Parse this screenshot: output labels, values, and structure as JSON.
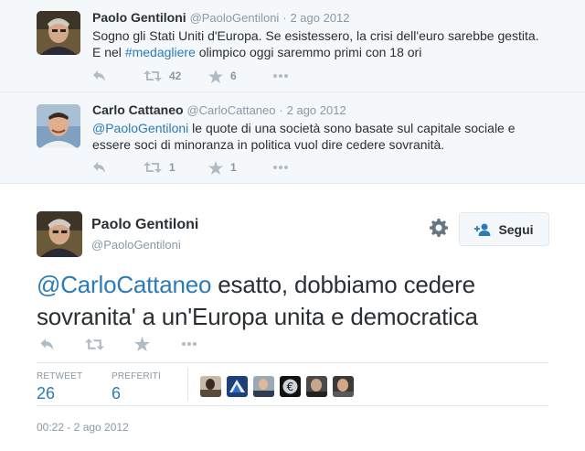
{
  "context_tweets": [
    {
      "fullname": "Paolo Gentiloni",
      "username": "@PaoloGentiloni",
      "separator": "·",
      "time": "2 ago 2012",
      "text_line1": "Sogno gli Stati Uniti d'Europa. Se esistessero, la crisi dell'euro sarebbe gestita.",
      "text_line2_pre": "E nel ",
      "hashtag": "#medagliere",
      "text_line2_post": " olimpico oggi saremmo primi con 18 ori",
      "retweets": "42",
      "favorites": "6"
    },
    {
      "fullname": "Carlo Cattaneo",
      "username": "@CarloCattaneo",
      "separator": "·",
      "time": "2 ago 2012",
      "mention": "@PaoloGentiloni",
      "text_line1_post": " le quote di una società sono basate sul capitale sociale e",
      "text_line2": "essere soci di minoranza in politica vuol dire cedere sovranità.",
      "retweets": "1",
      "favorites": "1"
    }
  ],
  "main_tweet": {
    "fullname": "Paolo Gentiloni",
    "username": "@PaoloGentiloni",
    "follow_label": "Segui",
    "mention": "@CarloCattaneo",
    "text_line1_post": " esatto, dobbiamo cedere",
    "text_line2": "sovranita' a un'Europa unita e democratica",
    "retweet_label": "RETWEET",
    "retweet_count": "26",
    "favorites_label": "PREFERITI",
    "favorites_count": "6",
    "timestamp": "00:22 - 2 ago 2012"
  },
  "icons": {
    "reply": "reply-icon",
    "retweet": "retweet-icon",
    "favorite": "star-icon",
    "more": "more-icon",
    "gear": "gear-icon",
    "follow": "add-user-icon"
  },
  "colors": {
    "link": "#2b7bb9",
    "muted": "#8899a6",
    "icon": "#b1bbc3",
    "context_bg": "#f5f8fa",
    "border": "#e1e8ed"
  }
}
